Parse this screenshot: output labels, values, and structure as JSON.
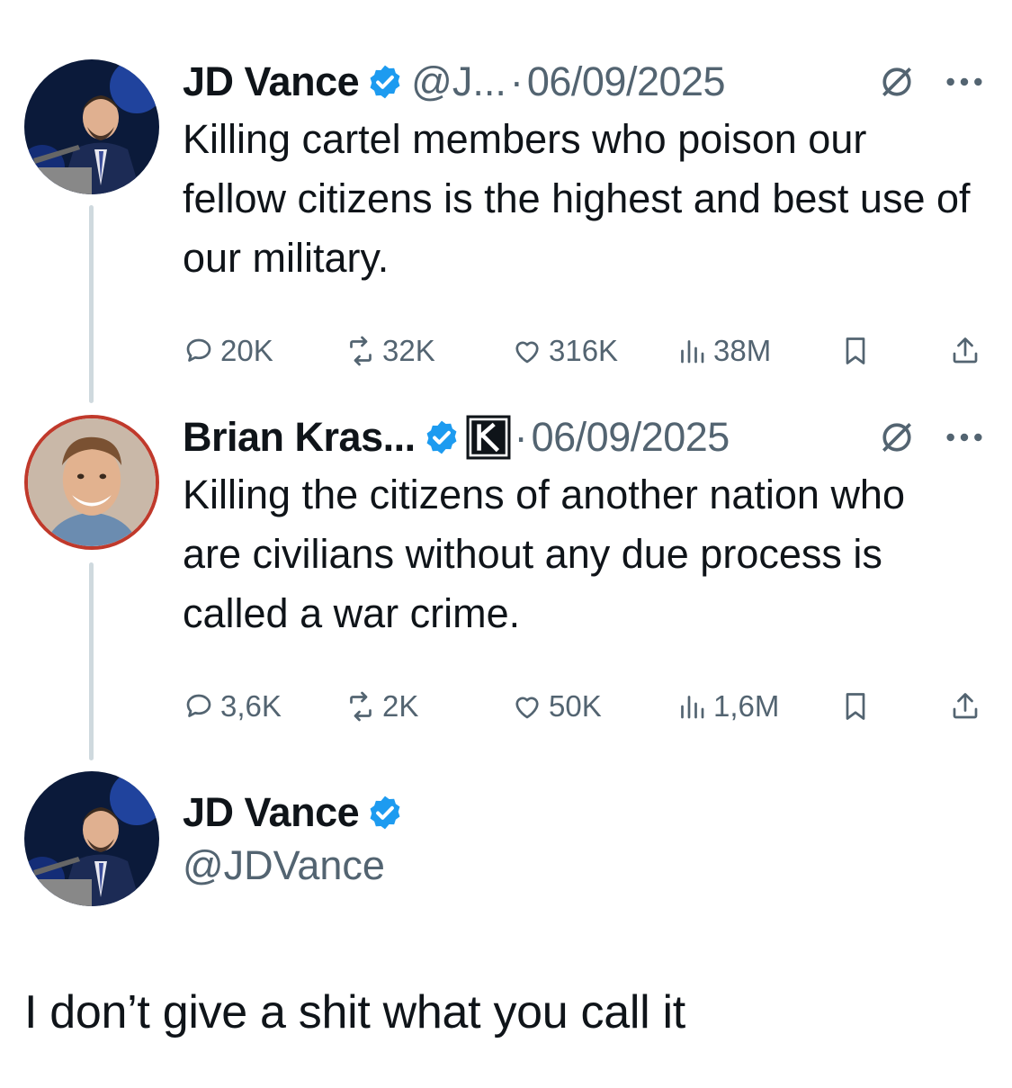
{
  "tweets": [
    {
      "name": "JD Vance",
      "handle": "@J...",
      "separator": "·",
      "date": "06/09/2025",
      "text": "Killing cartel members who poison our fellow citizens is the highest and best use of our military.",
      "stats": {
        "replies": "20K",
        "retweets": "32K",
        "likes": "316K",
        "views": "38M"
      }
    },
    {
      "name": "Brian Kras...",
      "separator": "·",
      "date": "06/09/2025",
      "text": "Killing the citizens of another nation who are civilians without any due process is called a war crime.",
      "stats": {
        "replies": "3,6K",
        "retweets": "2K",
        "likes": "50K",
        "views": "1,6M"
      }
    }
  ],
  "quoted_author": {
    "name": "JD Vance",
    "handle": "@JDVance"
  },
  "caption": "I don’t give a shit what you call it",
  "colors": {
    "verified": "#1d9bf0",
    "muted": "#536471",
    "thread_line": "#cfd9de",
    "text": "#0f1419"
  },
  "icons": [
    "verified-badge-icon",
    "slash-circle-icon",
    "more-icon",
    "reply-icon",
    "retweet-icon",
    "like-icon",
    "views-icon",
    "bookmark-icon",
    "share-icon",
    "k-logo-icon"
  ]
}
